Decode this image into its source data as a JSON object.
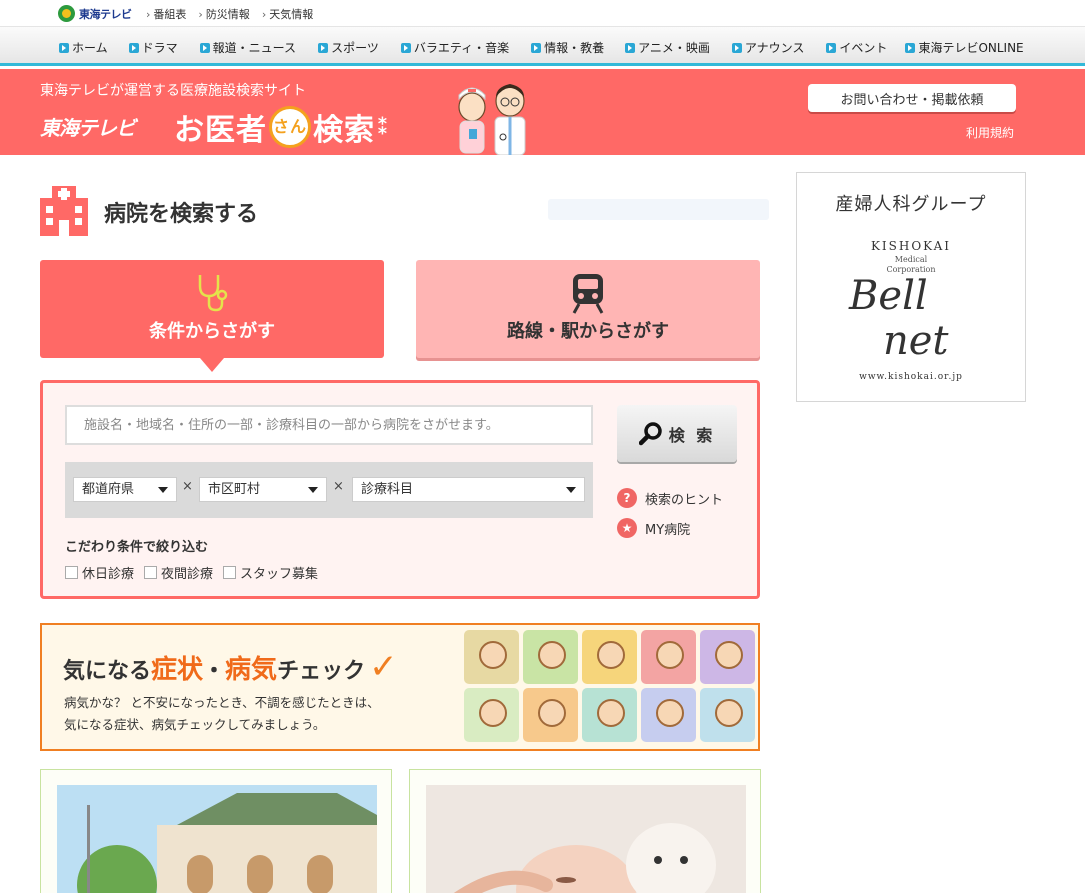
{
  "utility": {
    "logo_text": "東海テレビ",
    "links": [
      "番組表",
      "防災情報",
      "天気情報"
    ]
  },
  "gnav": {
    "items": [
      "ホーム",
      "ドラマ",
      "報道・ニュース",
      "スポーツ",
      "バラエティ・音楽",
      "情報・教養",
      "アニメ・映画",
      "アナウンス",
      "イベント",
      "東海テレビONLINE"
    ]
  },
  "header": {
    "tagline": "東海テレビが運営する医療施設検索サイト",
    "brand": "東海テレビ",
    "title_pre": "お医者",
    "title_circle": "さん",
    "title_post": "検索",
    "contact_label": "お問い合わせ・掲載依頼",
    "terms_label": "利用規約"
  },
  "search": {
    "section_title": "病院を検索する",
    "tab_condition": "条件からさがす",
    "tab_route": "路線・駅からさがす",
    "keyword_placeholder": "施設名・地域名・住所の一部・診療科目の一部から病院をさがせます。",
    "search_button": "検 索",
    "prefecture": "都道府県",
    "city": "市区町村",
    "department": "診療科目",
    "times_symbol": "×",
    "hint_label": "検索のヒント",
    "my_hospital_label": "MY病院",
    "filter_title": "こだわり条件で絞り込む",
    "filters": [
      "休日診療",
      "夜間診療",
      "スタッフ募集"
    ]
  },
  "symptom": {
    "title_1": "気になる",
    "title_hl1": "症状",
    "title_dot": "・",
    "title_hl2": "病気",
    "title_2": "チェック",
    "line1": "病気かな？ と不安になったとき、不調を感じたときは、",
    "line2": "気になる症状、病気チェックしてみましょう。"
  },
  "ad": {
    "title": "産婦人科グループ",
    "kishokai": "KISHOKAI",
    "medical": "Medical",
    "corporation": "Corporation",
    "bell": "Bell",
    "net": "net",
    "url": "www.kishokai.or.jp"
  },
  "colors": {
    "brand_red": "#ff6966",
    "nav_accent": "#33b9d8",
    "symptom_orange": "#f07f22"
  }
}
